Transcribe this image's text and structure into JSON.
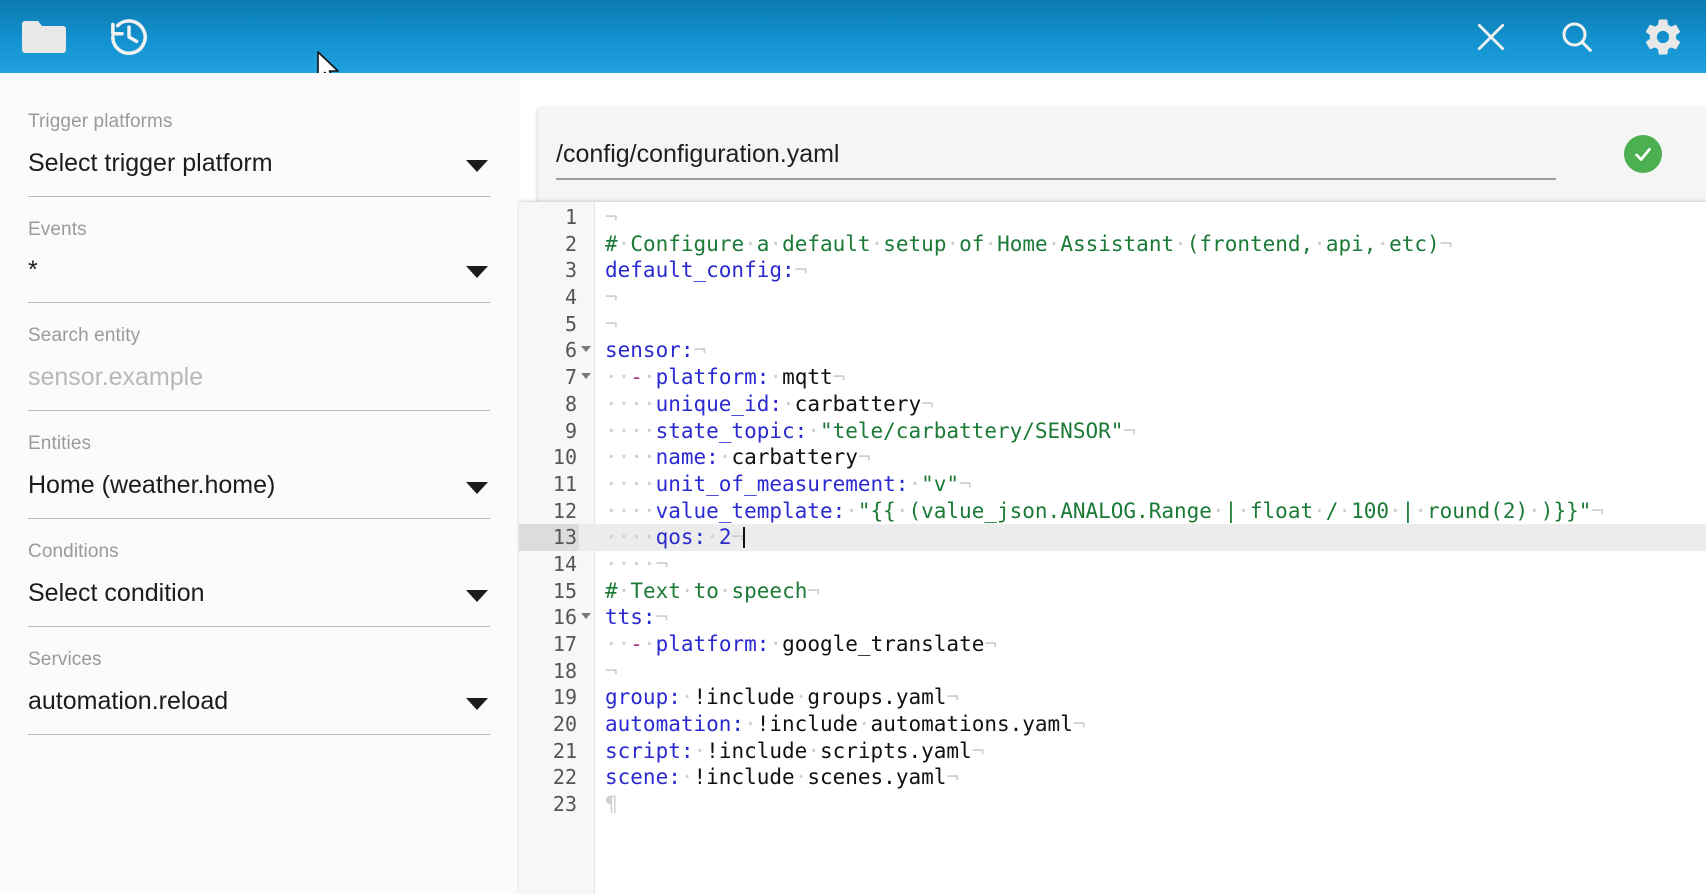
{
  "toolbar": {
    "left_buttons": [
      {
        "name": "folder-icon",
        "label": "Folder"
      },
      {
        "name": "history-icon",
        "label": "History"
      }
    ],
    "right_buttons": [
      {
        "name": "close-icon",
        "label": "Close"
      },
      {
        "name": "search-icon",
        "label": "Search"
      },
      {
        "name": "gear-icon",
        "label": "Settings"
      }
    ],
    "accent_color": "#1292cf"
  },
  "sidebar": {
    "fields": [
      {
        "label": "Trigger platforms",
        "value": "Select trigger platform",
        "placeholder": "",
        "caret": true,
        "is_placeholder": false
      },
      {
        "label": "Events",
        "value": "*",
        "placeholder": "",
        "caret": true,
        "is_placeholder": false
      },
      {
        "label": "Search entity",
        "value": "sensor.example",
        "placeholder": "sensor.example",
        "caret": false,
        "is_placeholder": true
      },
      {
        "label": "Entities",
        "value": "Home (weather.home)",
        "placeholder": "",
        "caret": true,
        "is_placeholder": false
      },
      {
        "label": "Conditions",
        "value": "Select condition",
        "placeholder": "",
        "caret": true,
        "is_placeholder": false
      },
      {
        "label": "Services",
        "value": "automation.reload",
        "placeholder": "",
        "caret": true,
        "is_placeholder": false
      }
    ]
  },
  "editor": {
    "file_path": "/config/configuration.yaml",
    "status_badge": {
      "name": "valid-check-badge",
      "state": "valid",
      "color": "#4caf50"
    },
    "active_line": 13,
    "cursor_line": 13,
    "lines": [
      {
        "n": 1,
        "fold": false,
        "text": "",
        "raw": ""
      },
      {
        "n": 2,
        "fold": false,
        "text": "# Configure a default setup of Home Assistant (frontend, api, etc)",
        "raw": "# Configure a default setup of Home Assistant (frontend, api, etc)"
      },
      {
        "n": 3,
        "fold": false,
        "text": "default_config:",
        "raw": "default_config:"
      },
      {
        "n": 4,
        "fold": false,
        "text": "",
        "raw": ""
      },
      {
        "n": 5,
        "fold": false,
        "text": "",
        "raw": ""
      },
      {
        "n": 6,
        "fold": true,
        "text": "sensor:",
        "raw": "sensor:"
      },
      {
        "n": 7,
        "fold": true,
        "text": "  - platform: mqtt",
        "raw": "  - platform: mqtt"
      },
      {
        "n": 8,
        "fold": false,
        "text": "    unique_id: carbattery",
        "raw": "    unique_id: carbattery"
      },
      {
        "n": 9,
        "fold": false,
        "text": "    state_topic: \"tele/carbattery/SENSOR\"",
        "raw": "    state_topic: \"tele/carbattery/SENSOR\""
      },
      {
        "n": 10,
        "fold": false,
        "text": "    name: carbattery",
        "raw": "    name: carbattery"
      },
      {
        "n": 11,
        "fold": false,
        "text": "    unit_of_measurement: \"v\"",
        "raw": "    unit_of_measurement: \"v\""
      },
      {
        "n": 12,
        "fold": false,
        "text": "    value_template: \"{{ (value_json.ANALOG.Range | float / 100 | round(2) )}}\"",
        "raw": "    value_template: \"{{ (value_json.ANALOG.Range | float / 100 | round(2) )}}\""
      },
      {
        "n": 13,
        "fold": false,
        "text": "    qos: 2",
        "raw": "    qos: 2"
      },
      {
        "n": 14,
        "fold": false,
        "text": "    ",
        "raw": "    "
      },
      {
        "n": 15,
        "fold": false,
        "text": "# Text to speech",
        "raw": "# Text to speech"
      },
      {
        "n": 16,
        "fold": true,
        "text": "tts:",
        "raw": "tts:"
      },
      {
        "n": 17,
        "fold": false,
        "text": "  - platform: google_translate",
        "raw": "  - platform: google_translate"
      },
      {
        "n": 18,
        "fold": false,
        "text": "",
        "raw": ""
      },
      {
        "n": 19,
        "fold": false,
        "text": "group: !include groups.yaml",
        "raw": "group: !include groups.yaml"
      },
      {
        "n": 20,
        "fold": false,
        "text": "automation: !include automations.yaml",
        "raw": "automation: !include automations.yaml"
      },
      {
        "n": 21,
        "fold": false,
        "text": "script: !include scripts.yaml",
        "raw": "script: !include scripts.yaml"
      },
      {
        "n": 22,
        "fold": false,
        "text": "scene: !include scenes.yaml",
        "raw": "scene: !include scenes.yaml"
      },
      {
        "n": 23,
        "fold": false,
        "text": "",
        "raw": "",
        "pilcrow": true
      }
    ]
  }
}
